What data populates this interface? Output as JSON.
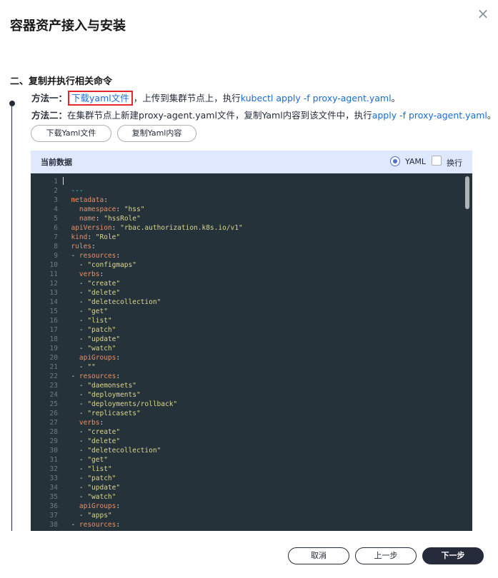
{
  "dialog": {
    "title": "容器资产接入与安装",
    "close_icon": "×"
  },
  "section": {
    "title": "二、复制并执行相关命令"
  },
  "method1": {
    "label": "方法一：",
    "link": "下载yaml文件",
    "text": "，上传到集群节点上，执行",
    "command": "kubectl apply -f proxy-agent.yaml",
    "end": "。"
  },
  "method2": {
    "label": "方法二：",
    "text": "在集群节点上新建proxy-agent.yaml文件，复制Yaml内容到该文件中，执行",
    "command": "apply -f proxy-agent.yaml",
    "end": "。"
  },
  "buttons": {
    "download": "下载Yaml文件",
    "copy": "复制Yaml内容"
  },
  "panel": {
    "title": "当前数据",
    "yaml_option": "YAML",
    "wrap_option": "换行"
  },
  "code_lines": [
    {
      "n": "1",
      "parts": [
        [
          "t",
          ""
        ]
      ]
    },
    {
      "n": "2",
      "parts": [
        [
          "d",
          "  ---"
        ]
      ]
    },
    {
      "n": "3",
      "parts": [
        [
          "k",
          "  metadata"
        ],
        [
          "t",
          ":"
        ]
      ]
    },
    {
      "n": "4",
      "parts": [
        [
          "k",
          "    namespace"
        ],
        [
          "t",
          ": "
        ],
        [
          "s",
          "\"hss\""
        ]
      ]
    },
    {
      "n": "5",
      "parts": [
        [
          "k",
          "    name"
        ],
        [
          "t",
          ": "
        ],
        [
          "s",
          "\"hssRole\""
        ]
      ]
    },
    {
      "n": "6",
      "parts": [
        [
          "k",
          "  apiVersion"
        ],
        [
          "t",
          ": "
        ],
        [
          "s",
          "\"rbac.authorization.k8s.io/v1\""
        ]
      ]
    },
    {
      "n": "7",
      "parts": [
        [
          "k",
          "  kind"
        ],
        [
          "t",
          ": "
        ],
        [
          "s",
          "\"Role\""
        ]
      ]
    },
    {
      "n": "8",
      "parts": [
        [
          "k",
          "  rules"
        ],
        [
          "t",
          ":"
        ]
      ]
    },
    {
      "n": "9",
      "parts": [
        [
          "t",
          "  - "
        ],
        [
          "k",
          "resources"
        ],
        [
          "t",
          ":"
        ]
      ]
    },
    {
      "n": "10",
      "parts": [
        [
          "t",
          "    - "
        ],
        [
          "s",
          "\"configmaps\""
        ]
      ]
    },
    {
      "n": "11",
      "parts": [
        [
          "k",
          "    verbs"
        ],
        [
          "t",
          ":"
        ]
      ]
    },
    {
      "n": "12",
      "parts": [
        [
          "t",
          "    - "
        ],
        [
          "s",
          "\"create\""
        ]
      ]
    },
    {
      "n": "13",
      "parts": [
        [
          "t",
          "    - "
        ],
        [
          "s",
          "\"delete\""
        ]
      ]
    },
    {
      "n": "14",
      "parts": [
        [
          "t",
          "    - "
        ],
        [
          "s",
          "\"deletecollection\""
        ]
      ]
    },
    {
      "n": "15",
      "parts": [
        [
          "t",
          "    - "
        ],
        [
          "s",
          "\"get\""
        ]
      ]
    },
    {
      "n": "16",
      "parts": [
        [
          "t",
          "    - "
        ],
        [
          "s",
          "\"list\""
        ]
      ]
    },
    {
      "n": "17",
      "parts": [
        [
          "t",
          "    - "
        ],
        [
          "s",
          "\"patch\""
        ]
      ]
    },
    {
      "n": "18",
      "parts": [
        [
          "t",
          "    - "
        ],
        [
          "s",
          "\"update\""
        ]
      ]
    },
    {
      "n": "19",
      "parts": [
        [
          "t",
          "    - "
        ],
        [
          "s",
          "\"watch\""
        ]
      ]
    },
    {
      "n": "20",
      "parts": [
        [
          "k",
          "    apiGroups"
        ],
        [
          "t",
          ":"
        ]
      ]
    },
    {
      "n": "21",
      "parts": [
        [
          "t",
          "    - "
        ],
        [
          "s",
          "\"\""
        ]
      ]
    },
    {
      "n": "22",
      "parts": [
        [
          "t",
          "  - "
        ],
        [
          "k",
          "resources"
        ],
        [
          "t",
          ":"
        ]
      ]
    },
    {
      "n": "23",
      "parts": [
        [
          "t",
          "    - "
        ],
        [
          "s",
          "\"daemonsets\""
        ]
      ]
    },
    {
      "n": "24",
      "parts": [
        [
          "t",
          "    - "
        ],
        [
          "s",
          "\"deployments\""
        ]
      ]
    },
    {
      "n": "25",
      "parts": [
        [
          "t",
          "    - "
        ],
        [
          "s",
          "\"deployments/rollback\""
        ]
      ]
    },
    {
      "n": "26",
      "parts": [
        [
          "t",
          "    - "
        ],
        [
          "s",
          "\"replicasets\""
        ]
      ]
    },
    {
      "n": "27",
      "parts": [
        [
          "k",
          "    verbs"
        ],
        [
          "t",
          ":"
        ]
      ]
    },
    {
      "n": "28",
      "parts": [
        [
          "t",
          "    - "
        ],
        [
          "s",
          "\"create\""
        ]
      ]
    },
    {
      "n": "29",
      "parts": [
        [
          "t",
          "    - "
        ],
        [
          "s",
          "\"delete\""
        ]
      ]
    },
    {
      "n": "30",
      "parts": [
        [
          "t",
          "    - "
        ],
        [
          "s",
          "\"deletecollection\""
        ]
      ]
    },
    {
      "n": "31",
      "parts": [
        [
          "t",
          "    - "
        ],
        [
          "s",
          "\"get\""
        ]
      ]
    },
    {
      "n": "32",
      "parts": [
        [
          "t",
          "    - "
        ],
        [
          "s",
          "\"list\""
        ]
      ]
    },
    {
      "n": "33",
      "parts": [
        [
          "t",
          "    - "
        ],
        [
          "s",
          "\"patch\""
        ]
      ]
    },
    {
      "n": "34",
      "parts": [
        [
          "t",
          "    - "
        ],
        [
          "s",
          "\"update\""
        ]
      ]
    },
    {
      "n": "35",
      "parts": [
        [
          "t",
          "    - "
        ],
        [
          "s",
          "\"watch\""
        ]
      ]
    },
    {
      "n": "36",
      "parts": [
        [
          "k",
          "    apiGroups"
        ],
        [
          "t",
          ":"
        ]
      ]
    },
    {
      "n": "37",
      "parts": [
        [
          "t",
          "    - "
        ],
        [
          "s",
          "\"apps\""
        ]
      ]
    },
    {
      "n": "38",
      "parts": [
        [
          "t",
          "  - "
        ],
        [
          "k",
          "resources"
        ],
        [
          "t",
          ":"
        ]
      ]
    }
  ],
  "footer": {
    "cancel": "取消",
    "prev": "上一步",
    "next": "下一步"
  },
  "colors": {
    "link": "#1a6bd6",
    "highlight_border": "#e5262b",
    "editor_bg": "#253239",
    "yaml_key": "#e88f69",
    "yaml_string": "#dcd68f",
    "primary_button": "#252b3a"
  }
}
